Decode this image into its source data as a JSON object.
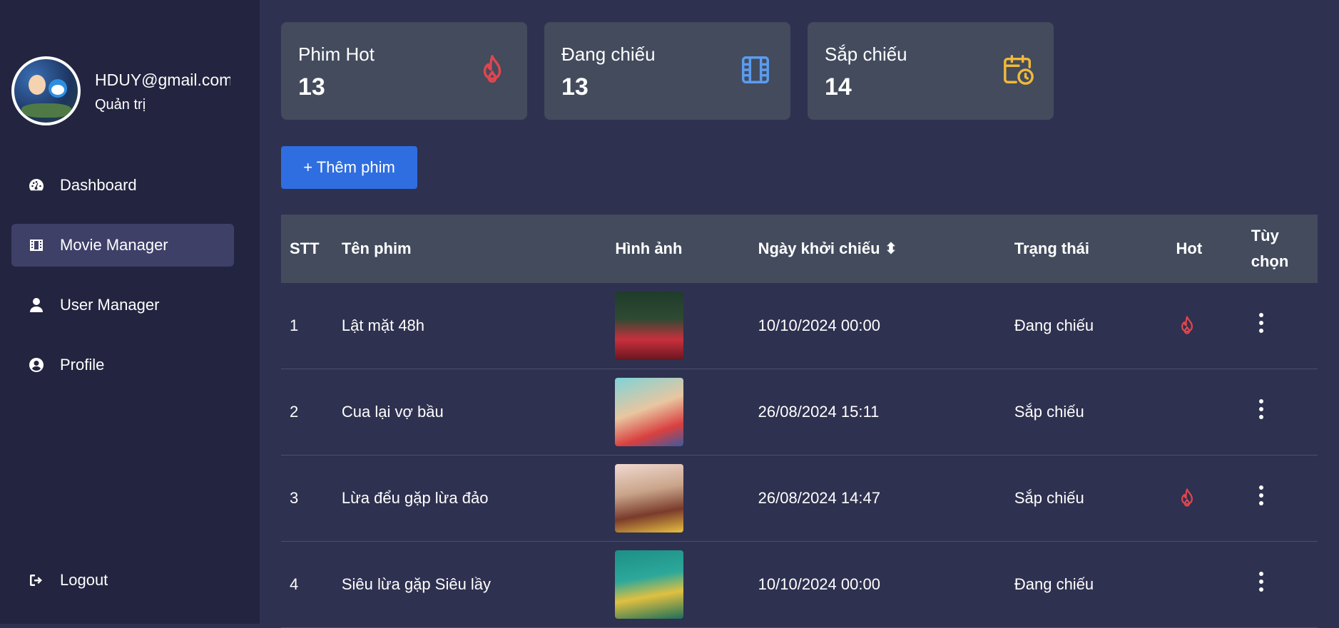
{
  "user": {
    "email": "HDUY@gmail.com",
    "role": "Quản trị"
  },
  "nav": [
    {
      "label": "Dashboard",
      "icon": "gauge-icon",
      "active": false
    },
    {
      "label": "Movie Manager",
      "icon": "film-icon",
      "active": true
    },
    {
      "label": "User Manager",
      "icon": "user-icon",
      "active": false
    },
    {
      "label": "Profile",
      "icon": "user-circle-icon",
      "active": false
    }
  ],
  "logout_label": "Logout",
  "stats": [
    {
      "title": "Phim Hot",
      "value": "13",
      "icon": "fire-icon",
      "color": "#e0464e"
    },
    {
      "title": "Đang chiếu",
      "value": "13",
      "icon": "film-icon",
      "color": "#5b9cf0"
    },
    {
      "title": "Sắp chiếu",
      "value": "14",
      "icon": "calendar-clock-icon",
      "color": "#f0b93a"
    }
  ],
  "add_button": "+ Thêm phim",
  "table": {
    "headers": {
      "stt": "STT",
      "name": "Tên phim",
      "image": "Hình ảnh",
      "date": "Ngày khởi chiếu ⬍",
      "status": "Trạng thái",
      "hot": "Hot",
      "options": "Tùy chọn"
    },
    "rows": [
      {
        "stt": "1",
        "name": "Lật mặt 48h",
        "date": "10/10/2024 00:00",
        "status": "Đang chiếu",
        "hot": true
      },
      {
        "stt": "2",
        "name": "Cua lại vợ bầu",
        "date": "26/08/2024 15:11",
        "status": "Sắp chiếu",
        "hot": false
      },
      {
        "stt": "3",
        "name": "Lừa đểu gặp lừa đảo",
        "date": "26/08/2024 14:47",
        "status": "Sắp chiếu",
        "hot": true
      },
      {
        "stt": "4",
        "name": "Siêu lừa gặp Siêu lầy",
        "date": "10/10/2024 00:00",
        "status": "Đang chiếu",
        "hot": false
      }
    ]
  },
  "colors": {
    "sidebar": "#23243f",
    "main": "#2f3150",
    "card": "#434b5d",
    "accent": "#2f6ee0",
    "hot": "#e0464e"
  }
}
